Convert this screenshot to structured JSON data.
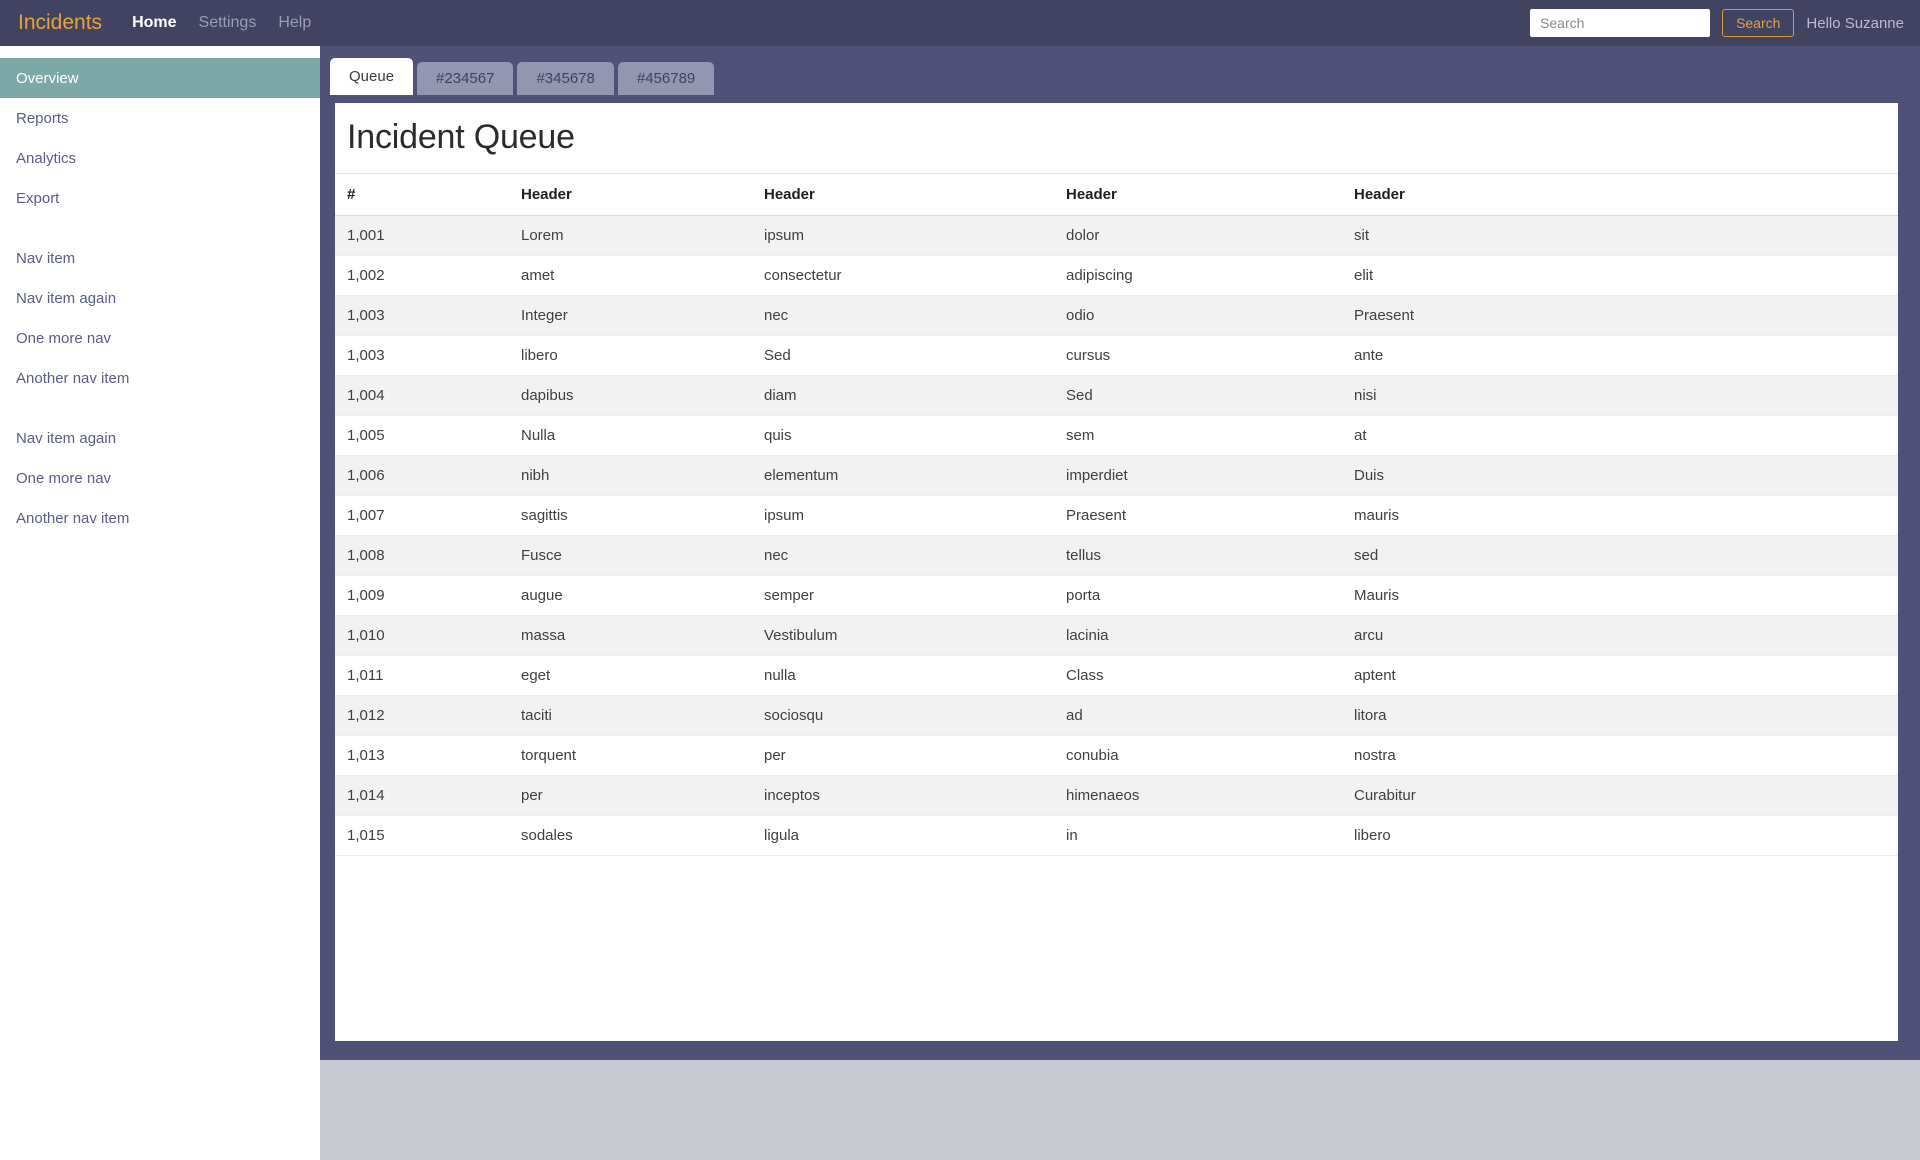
{
  "navbar": {
    "brand": "Incidents",
    "links": [
      {
        "label": "Home",
        "active": true
      },
      {
        "label": "Settings",
        "active": false
      },
      {
        "label": "Help",
        "active": false
      }
    ],
    "search_placeholder": "Search",
    "search_value": "",
    "search_button": "Search",
    "greeting": "Hello Suzanne",
    "brand_color": "#e6a33c",
    "bar_color": "#414361"
  },
  "sidebar": {
    "groups": [
      {
        "items": [
          {
            "label": "Overview",
            "active": true
          },
          {
            "label": "Reports",
            "active": false
          },
          {
            "label": "Analytics",
            "active": false
          },
          {
            "label": "Export",
            "active": false
          }
        ]
      },
      {
        "items": [
          {
            "label": "Nav item",
            "active": false
          },
          {
            "label": "Nav item again",
            "active": false
          },
          {
            "label": "One more nav",
            "active": false
          },
          {
            "label": "Another nav item",
            "active": false
          }
        ]
      },
      {
        "items": [
          {
            "label": "Nav item again",
            "active": false
          },
          {
            "label": "One more nav",
            "active": false
          },
          {
            "label": "Another nav item",
            "active": false
          }
        ]
      }
    ],
    "active_color": "#7da8a8",
    "link_color": "#5a5d86"
  },
  "tabs": [
    {
      "label": "Queue",
      "active": true
    },
    {
      "label": "#234567",
      "active": false
    },
    {
      "label": "#345678",
      "active": false
    },
    {
      "label": "#456789",
      "active": false
    }
  ],
  "main": {
    "title": "Incident Queue",
    "table": {
      "columns": [
        "#",
        "Header",
        "Header",
        "Header",
        "Header"
      ],
      "rows": [
        [
          "1,001",
          "Lorem",
          "ipsum",
          "dolor",
          "sit"
        ],
        [
          "1,002",
          "amet",
          "consectetur",
          "adipiscing",
          "elit"
        ],
        [
          "1,003",
          "Integer",
          "nec",
          "odio",
          "Praesent"
        ],
        [
          "1,003",
          "libero",
          "Sed",
          "cursus",
          "ante"
        ],
        [
          "1,004",
          "dapibus",
          "diam",
          "Sed",
          "nisi"
        ],
        [
          "1,005",
          "Nulla",
          "quis",
          "sem",
          "at"
        ],
        [
          "1,006",
          "nibh",
          "elementum",
          "imperdiet",
          "Duis"
        ],
        [
          "1,007",
          "sagittis",
          "ipsum",
          "Praesent",
          "mauris"
        ],
        [
          "1,008",
          "Fusce",
          "nec",
          "tellus",
          "sed"
        ],
        [
          "1,009",
          "augue",
          "semper",
          "porta",
          "Mauris"
        ],
        [
          "1,010",
          "massa",
          "Vestibulum",
          "lacinia",
          "arcu"
        ],
        [
          "1,011",
          "eget",
          "nulla",
          "Class",
          "aptent"
        ],
        [
          "1,012",
          "taciti",
          "sociosqu",
          "ad",
          "litora"
        ],
        [
          "1,013",
          "torquent",
          "per",
          "conubia",
          "nostra"
        ],
        [
          "1,014",
          "per",
          "inceptos",
          "himenaeos",
          "Curabitur"
        ],
        [
          "1,015",
          "sodales",
          "ligula",
          "in",
          "libero"
        ]
      ]
    }
  },
  "theme": {
    "frame_color": "#4f5276",
    "panel_bg": "#ffffff",
    "row_alt_bg": "#f2f2f2",
    "bottom_strip": "#c8c9ce"
  }
}
